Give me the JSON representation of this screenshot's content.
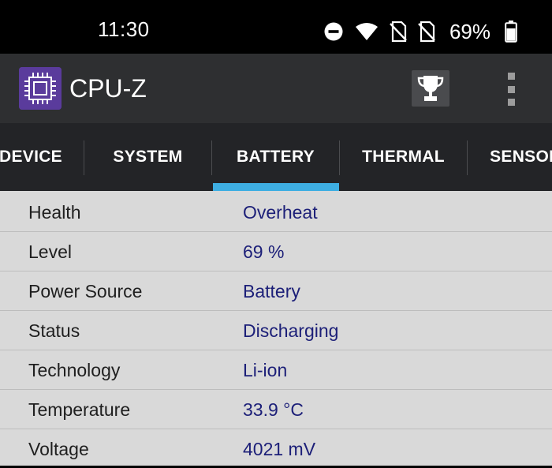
{
  "status_bar": {
    "time": "11:30",
    "battery_percent": "69%",
    "icons": [
      "do-not-disturb-icon",
      "wifi-icon",
      "no-sim-icon",
      "no-sim-icon",
      "battery-icon"
    ]
  },
  "app_bar": {
    "title": "CPU-Z",
    "logo_icon": "cpu-chip-icon",
    "trophy_icon": "trophy-icon",
    "menu_icon": "overflow-menu-icon"
  },
  "tabs": [
    {
      "label": "DEVICE",
      "active": false
    },
    {
      "label": "SYSTEM",
      "active": false
    },
    {
      "label": "BATTERY",
      "active": true
    },
    {
      "label": "THERMAL",
      "active": false
    },
    {
      "label": "SENSORS",
      "active": false
    }
  ],
  "colors": {
    "accent": "#3eaee2",
    "value_text": "#1c1f78",
    "app_bar": "#2e2f31",
    "tab_bar": "#232427",
    "content_bg": "#d9d9d9"
  },
  "battery": {
    "rows": [
      {
        "label": "Health",
        "value": "Overheat"
      },
      {
        "label": "Level",
        "value": "69 %"
      },
      {
        "label": "Power Source",
        "value": "Battery"
      },
      {
        "label": "Status",
        "value": "Discharging"
      },
      {
        "label": "Technology",
        "value": "Li-ion"
      },
      {
        "label": "Temperature",
        "value": "33.9 °C"
      },
      {
        "label": "Voltage",
        "value": "4021 mV"
      }
    ]
  }
}
